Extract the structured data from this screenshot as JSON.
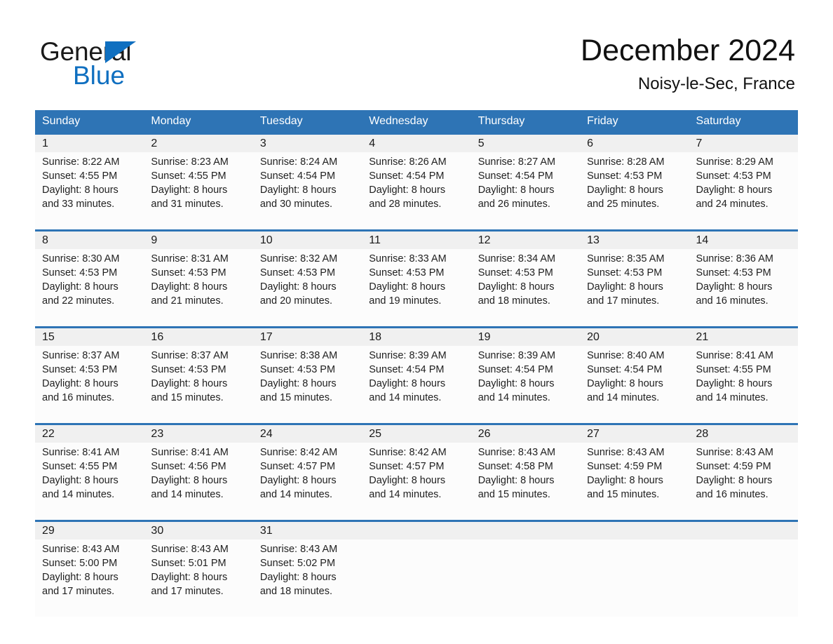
{
  "brand": {
    "logo_word_1": "General",
    "logo_word_2": "Blue",
    "logo_primary_color": "#0f6fc0",
    "logo_text_color": "#1a1a1a"
  },
  "header": {
    "title": "December 2024",
    "subtitle": "Noisy-le-Sec, France"
  },
  "theme": {
    "header_bar_color": "#2e74b5",
    "date_band_color": "#f0f0f0",
    "cell_background": "#fcfcfc",
    "page_background": "#ffffff"
  },
  "weekday_headers": [
    "Sunday",
    "Monday",
    "Tuesday",
    "Wednesday",
    "Thursday",
    "Friday",
    "Saturday"
  ],
  "weeks": [
    {
      "days": [
        {
          "date": "1",
          "sunrise": "Sunrise: 8:22 AM",
          "sunset": "Sunset: 4:55 PM",
          "daylight_1": "Daylight: 8 hours",
          "daylight_2": "and 33 minutes."
        },
        {
          "date": "2",
          "sunrise": "Sunrise: 8:23 AM",
          "sunset": "Sunset: 4:55 PM",
          "daylight_1": "Daylight: 8 hours",
          "daylight_2": "and 31 minutes."
        },
        {
          "date": "3",
          "sunrise": "Sunrise: 8:24 AM",
          "sunset": "Sunset: 4:54 PM",
          "daylight_1": "Daylight: 8 hours",
          "daylight_2": "and 30 minutes."
        },
        {
          "date": "4",
          "sunrise": "Sunrise: 8:26 AM",
          "sunset": "Sunset: 4:54 PM",
          "daylight_1": "Daylight: 8 hours",
          "daylight_2": "and 28 minutes."
        },
        {
          "date": "5",
          "sunrise": "Sunrise: 8:27 AM",
          "sunset": "Sunset: 4:54 PM",
          "daylight_1": "Daylight: 8 hours",
          "daylight_2": "and 26 minutes."
        },
        {
          "date": "6",
          "sunrise": "Sunrise: 8:28 AM",
          "sunset": "Sunset: 4:53 PM",
          "daylight_1": "Daylight: 8 hours",
          "daylight_2": "and 25 minutes."
        },
        {
          "date": "7",
          "sunrise": "Sunrise: 8:29 AM",
          "sunset": "Sunset: 4:53 PM",
          "daylight_1": "Daylight: 8 hours",
          "daylight_2": "and 24 minutes."
        }
      ]
    },
    {
      "days": [
        {
          "date": "8",
          "sunrise": "Sunrise: 8:30 AM",
          "sunset": "Sunset: 4:53 PM",
          "daylight_1": "Daylight: 8 hours",
          "daylight_2": "and 22 minutes."
        },
        {
          "date": "9",
          "sunrise": "Sunrise: 8:31 AM",
          "sunset": "Sunset: 4:53 PM",
          "daylight_1": "Daylight: 8 hours",
          "daylight_2": "and 21 minutes."
        },
        {
          "date": "10",
          "sunrise": "Sunrise: 8:32 AM",
          "sunset": "Sunset: 4:53 PM",
          "daylight_1": "Daylight: 8 hours",
          "daylight_2": "and 20 minutes."
        },
        {
          "date": "11",
          "sunrise": "Sunrise: 8:33 AM",
          "sunset": "Sunset: 4:53 PM",
          "daylight_1": "Daylight: 8 hours",
          "daylight_2": "and 19 minutes."
        },
        {
          "date": "12",
          "sunrise": "Sunrise: 8:34 AM",
          "sunset": "Sunset: 4:53 PM",
          "daylight_1": "Daylight: 8 hours",
          "daylight_2": "and 18 minutes."
        },
        {
          "date": "13",
          "sunrise": "Sunrise: 8:35 AM",
          "sunset": "Sunset: 4:53 PM",
          "daylight_1": "Daylight: 8 hours",
          "daylight_2": "and 17 minutes."
        },
        {
          "date": "14",
          "sunrise": "Sunrise: 8:36 AM",
          "sunset": "Sunset: 4:53 PM",
          "daylight_1": "Daylight: 8 hours",
          "daylight_2": "and 16 minutes."
        }
      ]
    },
    {
      "days": [
        {
          "date": "15",
          "sunrise": "Sunrise: 8:37 AM",
          "sunset": "Sunset: 4:53 PM",
          "daylight_1": "Daylight: 8 hours",
          "daylight_2": "and 16 minutes."
        },
        {
          "date": "16",
          "sunrise": "Sunrise: 8:37 AM",
          "sunset": "Sunset: 4:53 PM",
          "daylight_1": "Daylight: 8 hours",
          "daylight_2": "and 15 minutes."
        },
        {
          "date": "17",
          "sunrise": "Sunrise: 8:38 AM",
          "sunset": "Sunset: 4:53 PM",
          "daylight_1": "Daylight: 8 hours",
          "daylight_2": "and 15 minutes."
        },
        {
          "date": "18",
          "sunrise": "Sunrise: 8:39 AM",
          "sunset": "Sunset: 4:54 PM",
          "daylight_1": "Daylight: 8 hours",
          "daylight_2": "and 14 minutes."
        },
        {
          "date": "19",
          "sunrise": "Sunrise: 8:39 AM",
          "sunset": "Sunset: 4:54 PM",
          "daylight_1": "Daylight: 8 hours",
          "daylight_2": "and 14 minutes."
        },
        {
          "date": "20",
          "sunrise": "Sunrise: 8:40 AM",
          "sunset": "Sunset: 4:54 PM",
          "daylight_1": "Daylight: 8 hours",
          "daylight_2": "and 14 minutes."
        },
        {
          "date": "21",
          "sunrise": "Sunrise: 8:41 AM",
          "sunset": "Sunset: 4:55 PM",
          "daylight_1": "Daylight: 8 hours",
          "daylight_2": "and 14 minutes."
        }
      ]
    },
    {
      "days": [
        {
          "date": "22",
          "sunrise": "Sunrise: 8:41 AM",
          "sunset": "Sunset: 4:55 PM",
          "daylight_1": "Daylight: 8 hours",
          "daylight_2": "and 14 minutes."
        },
        {
          "date": "23",
          "sunrise": "Sunrise: 8:41 AM",
          "sunset": "Sunset: 4:56 PM",
          "daylight_1": "Daylight: 8 hours",
          "daylight_2": "and 14 minutes."
        },
        {
          "date": "24",
          "sunrise": "Sunrise: 8:42 AM",
          "sunset": "Sunset: 4:57 PM",
          "daylight_1": "Daylight: 8 hours",
          "daylight_2": "and 14 minutes."
        },
        {
          "date": "25",
          "sunrise": "Sunrise: 8:42 AM",
          "sunset": "Sunset: 4:57 PM",
          "daylight_1": "Daylight: 8 hours",
          "daylight_2": "and 14 minutes."
        },
        {
          "date": "26",
          "sunrise": "Sunrise: 8:43 AM",
          "sunset": "Sunset: 4:58 PM",
          "daylight_1": "Daylight: 8 hours",
          "daylight_2": "and 15 minutes."
        },
        {
          "date": "27",
          "sunrise": "Sunrise: 8:43 AM",
          "sunset": "Sunset: 4:59 PM",
          "daylight_1": "Daylight: 8 hours",
          "daylight_2": "and 15 minutes."
        },
        {
          "date": "28",
          "sunrise": "Sunrise: 8:43 AM",
          "sunset": "Sunset: 4:59 PM",
          "daylight_1": "Daylight: 8 hours",
          "daylight_2": "and 16 minutes."
        }
      ]
    },
    {
      "days": [
        {
          "date": "29",
          "sunrise": "Sunrise: 8:43 AM",
          "sunset": "Sunset: 5:00 PM",
          "daylight_1": "Daylight: 8 hours",
          "daylight_2": "and 17 minutes."
        },
        {
          "date": "30",
          "sunrise": "Sunrise: 8:43 AM",
          "sunset": "Sunset: 5:01 PM",
          "daylight_1": "Daylight: 8 hours",
          "daylight_2": "and 17 minutes."
        },
        {
          "date": "31",
          "sunrise": "Sunrise: 8:43 AM",
          "sunset": "Sunset: 5:02 PM",
          "daylight_1": "Daylight: 8 hours",
          "daylight_2": "and 18 minutes."
        },
        {
          "date": "",
          "sunrise": "",
          "sunset": "",
          "daylight_1": "",
          "daylight_2": ""
        },
        {
          "date": "",
          "sunrise": "",
          "sunset": "",
          "daylight_1": "",
          "daylight_2": ""
        },
        {
          "date": "",
          "sunrise": "",
          "sunset": "",
          "daylight_1": "",
          "daylight_2": ""
        },
        {
          "date": "",
          "sunrise": "",
          "sunset": "",
          "daylight_1": "",
          "daylight_2": ""
        }
      ]
    }
  ]
}
